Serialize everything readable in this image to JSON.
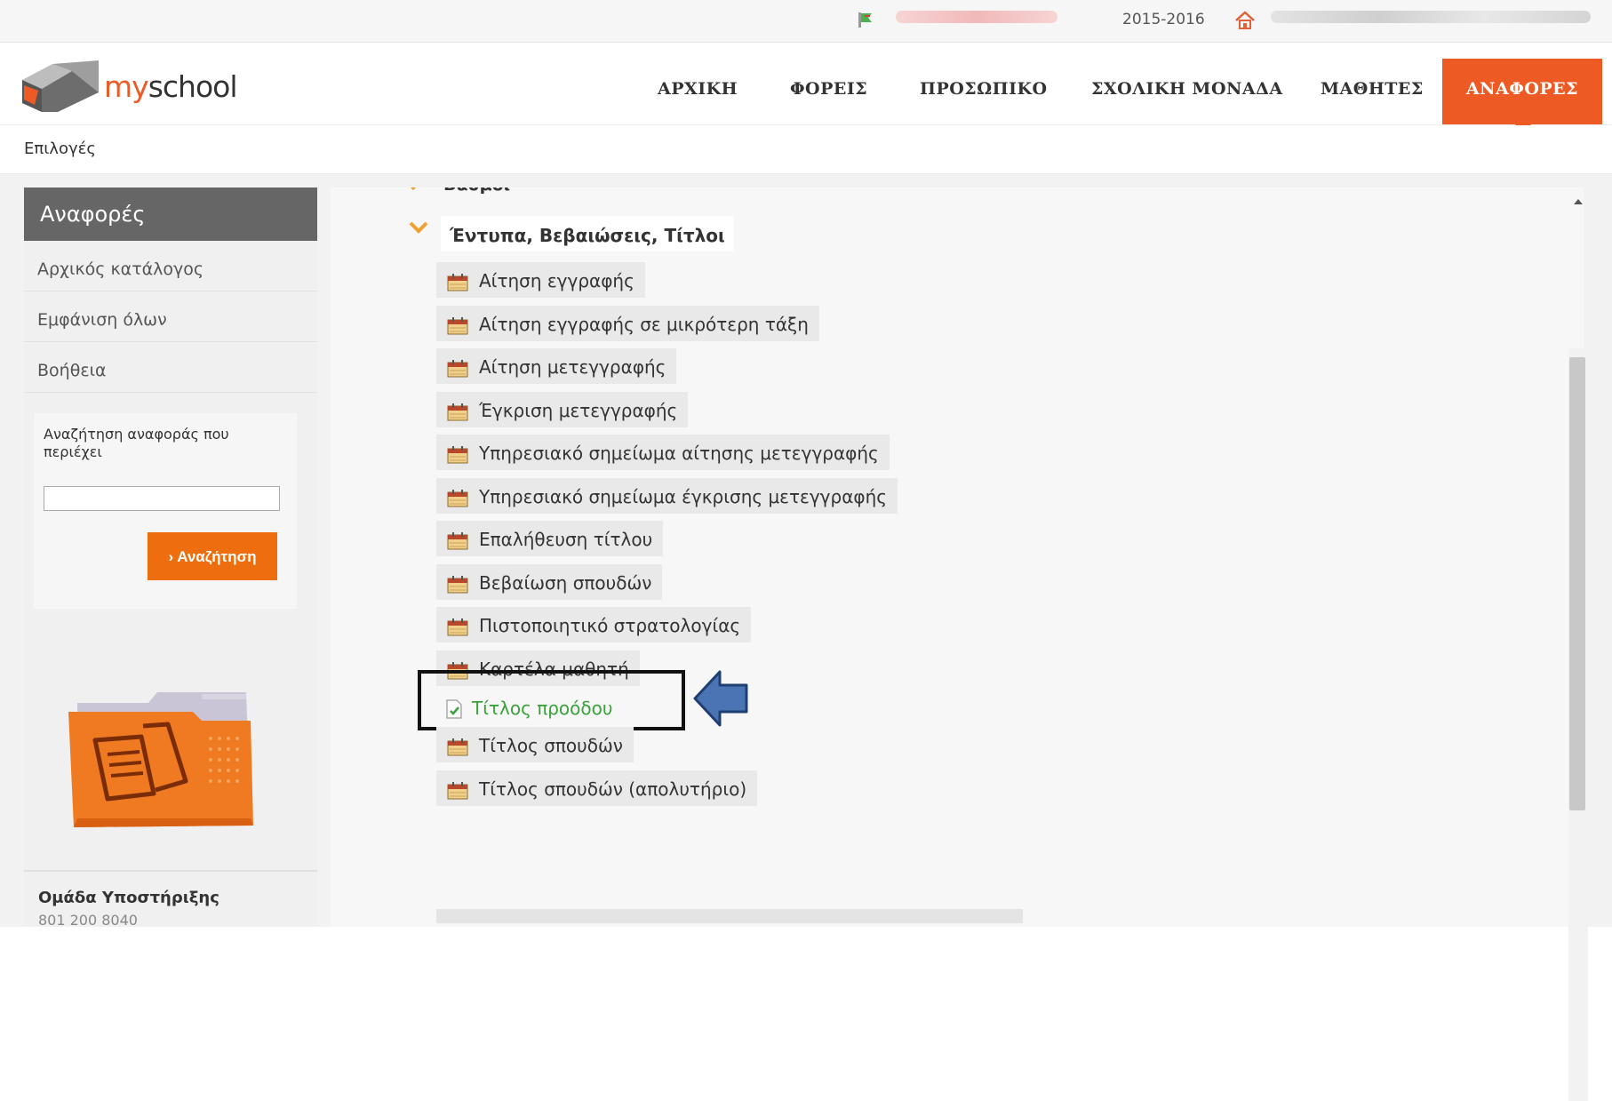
{
  "topbar": {
    "year": "2015-2016"
  },
  "brand": {
    "logo_my": "my",
    "logo_school": "school"
  },
  "nav": {
    "items": [
      "ΑΡΧΙΚΗ",
      "ΦΟΡΕΙΣ",
      "ΠΡΟΣΩΠΙΚΟ",
      "ΣΧΟΛΙΚΗ ΜΟΝΑΔΑ",
      "ΜΑΘΗΤΕΣ",
      "ΑΝΑΦΟΡΕΣ"
    ],
    "active": "ΑΝΑΦΟΡΕΣ"
  },
  "breadcrumb": "Επιλογές",
  "sidebar": {
    "title": "Αναφορές",
    "items": [
      "Αρχικός κατάλογος",
      "Εμφάνιση όλων",
      "Βοήθεια"
    ],
    "search_label": "Αναζήτηση αναφοράς που περιέχει",
    "search_value": "",
    "search_button": "Αναζήτηση",
    "support_title": "Ομάδα Υποστήριξης",
    "support_phone": "801 200 8040"
  },
  "main": {
    "previous_section": "Βαθμοί",
    "section_title": "Έντυπα, Βεβαιώσεις, Τίτλοι",
    "reports": [
      "Αίτηση εγγραφής",
      "Αίτηση εγγραφής σε μικρότερη τάξη",
      "Αίτηση μετεγγραφής",
      "Έγκριση μετεγγραφής",
      "Υπηρεσιακό σημείωμα αίτησης μετεγγραφής",
      "Υπηρεσιακό σημείωμα έγκρισης μετεγγραφής",
      "Επαλήθευση τίτλου",
      "Βεβαίωση σπουδών",
      "Πιστοποιητικό στρατολογίας",
      "Καρτέλα μαθητή"
    ],
    "highlighted_report": "Τίτλος προόδου",
    "reports_after": [
      "Τίτλος σπουδών",
      "Τίτλος σπουδών (απολυτήριο)"
    ]
  },
  "colors": {
    "accent": "#ee5a24",
    "button": "#ee6e0f",
    "sidebar_header": "#666666",
    "highlight_text": "#3aa23a",
    "arrow": "#4a74b4"
  },
  "icons": [
    "flag-icon",
    "home-icon",
    "calendar-icon",
    "document-check-icon",
    "arrow-left-icon",
    "chevron-down-icon",
    "folder-illustration"
  ]
}
